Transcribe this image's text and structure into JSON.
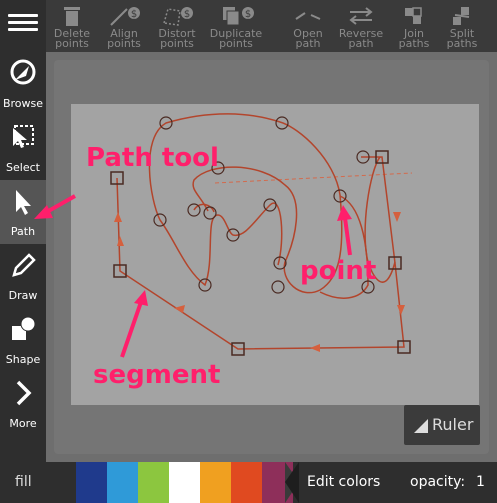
{
  "sidebar": {
    "items": [
      {
        "label": "Browse"
      },
      {
        "label": "Select"
      },
      {
        "label": "Path"
      },
      {
        "label": "Draw"
      },
      {
        "label": "Shape"
      },
      {
        "label": "More"
      }
    ]
  },
  "toolbar": {
    "buttons": [
      {
        "line1": "Delete",
        "line2": "points"
      },
      {
        "line1": "Align",
        "line2": "points"
      },
      {
        "line1": "Distort",
        "line2": "points"
      },
      {
        "line1": "Duplicate",
        "line2": "points"
      },
      {
        "line1": "Open",
        "line2": "path"
      },
      {
        "line1": "Reverse",
        "line2": "path"
      },
      {
        "line1": "Join",
        "line2": "paths"
      },
      {
        "line1": "Split",
        "line2": "paths"
      }
    ]
  },
  "annotations": {
    "path_tool": "Path tool",
    "point": "point",
    "segment": "segment"
  },
  "ruler": {
    "label": "Ruler"
  },
  "bottom": {
    "fill_label": "fill",
    "edit_colors": "Edit colors",
    "opacity_label": "opacity:",
    "opacity_value": "1",
    "swatches": [
      "#1f3a8c",
      "#2f9ad8",
      "#8cc63f",
      "#ffffff",
      "#f0a020",
      "#e04a20",
      "#8e2f5a"
    ]
  },
  "colors": {
    "accent": "#ff1f6b",
    "path_stroke": "#b3452c"
  }
}
